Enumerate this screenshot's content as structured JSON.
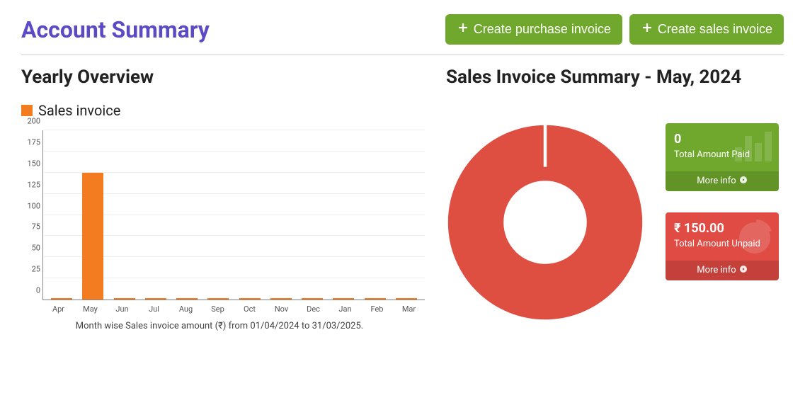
{
  "header": {
    "title": "Account Summary",
    "create_purchase": "Create purchase invoice",
    "create_sales": "Create sales invoice"
  },
  "left": {
    "title": "Yearly Overview",
    "legend": "Sales invoice",
    "caption": "Month wise Sales invoice amount (₹) from 01/04/2024 to 31/03/2025."
  },
  "right": {
    "title": "Sales Invoice Summary - May, 2024"
  },
  "cards": {
    "paid_value": "0",
    "paid_label": "Total Amount Paid",
    "unpaid_value": "₹ 150.00",
    "unpaid_label": "Total Amount Unpaid",
    "more_info": "More info"
  },
  "colors": {
    "accent": "#5a4bc4",
    "btn": "#6fa82c",
    "bar": "#f47c20",
    "donut": "#de4f42",
    "card_green": "#6fa82c",
    "card_red": "#e04b44"
  },
  "chart_data": [
    {
      "type": "bar",
      "title": "Yearly Overview",
      "legend": [
        "Sales invoice"
      ],
      "xlabel": "",
      "ylabel": "",
      "ylim": [
        0,
        200
      ],
      "yticks": [
        0,
        25,
        50,
        75,
        100,
        125,
        150,
        175,
        200
      ],
      "categories": [
        "Apr",
        "May",
        "Jun",
        "Jul",
        "Aug",
        "Sep",
        "Oct",
        "Nov",
        "Dec",
        "Jan",
        "Feb",
        "Mar"
      ],
      "values": [
        0,
        150,
        0,
        0,
        0,
        0,
        0,
        0,
        0,
        0,
        0,
        0
      ],
      "caption": "Month wise Sales invoice amount (₹) from 01/04/2024 to 31/03/2025.",
      "period_start": "01/04/2024",
      "period_end": "31/03/2025"
    },
    {
      "type": "pie",
      "title": "Sales Invoice Summary - May, 2024",
      "series": [
        {
          "name": "Total Amount Paid",
          "value": 0
        },
        {
          "name": "Total Amount Unpaid",
          "value": 150.0
        }
      ],
      "currency": "₹"
    }
  ]
}
